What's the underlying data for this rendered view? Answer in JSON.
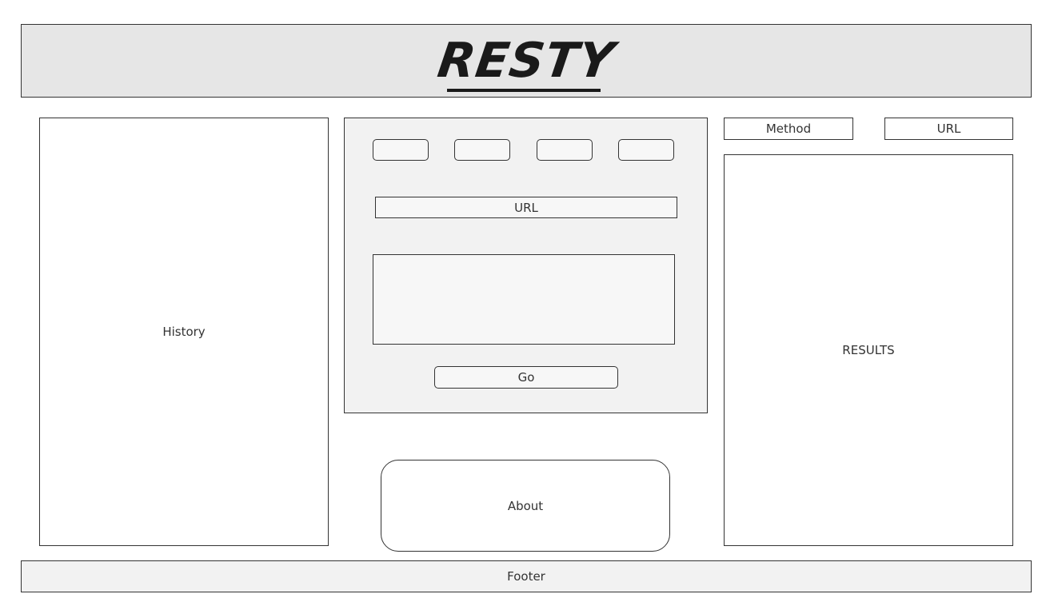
{
  "header": {
    "logo_text": "RESTY"
  },
  "history": {
    "label": "History"
  },
  "form": {
    "method_buttons": [
      "",
      "",
      "",
      ""
    ],
    "url_label": "URL",
    "body_text": "",
    "go_label": "Go"
  },
  "about": {
    "label": "About"
  },
  "results": {
    "method_label": "Method",
    "url_label": "URL",
    "label": "RESULTS"
  },
  "footer": {
    "label": "Footer"
  }
}
